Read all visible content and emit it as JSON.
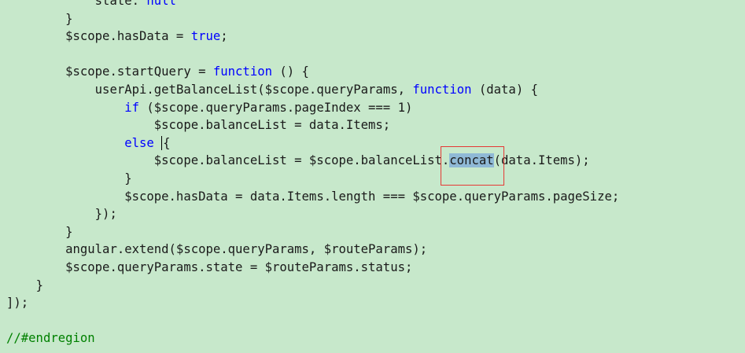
{
  "editor": {
    "lines": [
      {
        "indent": "            ",
        "parts": [
          {
            "t": "state: "
          },
          {
            "t": "null",
            "cls": "kw"
          }
        ]
      },
      {
        "indent": "        ",
        "parts": [
          {
            "t": "}"
          }
        ]
      },
      {
        "indent": "        ",
        "parts": [
          {
            "t": "$scope.hasData = "
          },
          {
            "t": "true",
            "cls": "kw"
          },
          {
            "t": ";"
          }
        ]
      },
      {
        "indent": "",
        "parts": []
      },
      {
        "indent": "        ",
        "parts": [
          {
            "t": "$scope.startQuery = "
          },
          {
            "t": "function",
            "cls": "kw"
          },
          {
            "t": " () {"
          }
        ]
      },
      {
        "indent": "            ",
        "parts": [
          {
            "t": "userApi.getBalanceList($scope.queryParams, "
          },
          {
            "t": "function",
            "cls": "kw"
          },
          {
            "t": " (data) {"
          }
        ]
      },
      {
        "indent": "                ",
        "parts": [
          {
            "t": "if",
            "cls": "kw"
          },
          {
            "t": " ($scope.queryParams.pageIndex === 1)"
          }
        ]
      },
      {
        "indent": "                    ",
        "parts": [
          {
            "t": "$scope.balanceList = data.Items;"
          }
        ]
      },
      {
        "indent": "                ",
        "parts": [
          {
            "t": "else",
            "cls": "kw"
          },
          {
            "t": " "
          },
          {
            "t": "",
            "cls": "caret"
          },
          {
            "t": "{"
          }
        ]
      },
      {
        "indent": "                    ",
        "parts": [
          {
            "t": "$scope.balanceList = $scope.balanceList."
          },
          {
            "t": "concat",
            "cls": "hl"
          },
          {
            "t": "(data.Items);"
          }
        ]
      },
      {
        "indent": "                ",
        "parts": [
          {
            "t": "}"
          }
        ]
      },
      {
        "indent": "                ",
        "parts": [
          {
            "t": "$scope.hasData = data.Items.length === $scope.queryParams.pageSize;"
          }
        ]
      },
      {
        "indent": "            ",
        "parts": [
          {
            "t": "});"
          }
        ]
      },
      {
        "indent": "        ",
        "parts": [
          {
            "t": "}"
          }
        ]
      },
      {
        "indent": "        ",
        "parts": [
          {
            "t": "angular.extend($scope.queryParams, $routeParams);"
          }
        ]
      },
      {
        "indent": "        ",
        "parts": [
          {
            "t": "$scope.queryParams.state = $routeParams.status;"
          }
        ]
      },
      {
        "indent": "    ",
        "parts": [
          {
            "t": "}"
          }
        ]
      },
      {
        "indent": "",
        "parts": [
          {
            "t": "]);"
          }
        ]
      },
      {
        "indent": "",
        "parts": []
      },
      {
        "indent": "",
        "parts": [
          {
            "t": "//#endregion",
            "cls": "cm"
          }
        ]
      }
    ]
  },
  "colors": {
    "background": "#c7e8cb",
    "keyword": "#0000ff",
    "comment": "#008000",
    "selection": "#8fb9d6",
    "highlight_box": "#e53935"
  }
}
